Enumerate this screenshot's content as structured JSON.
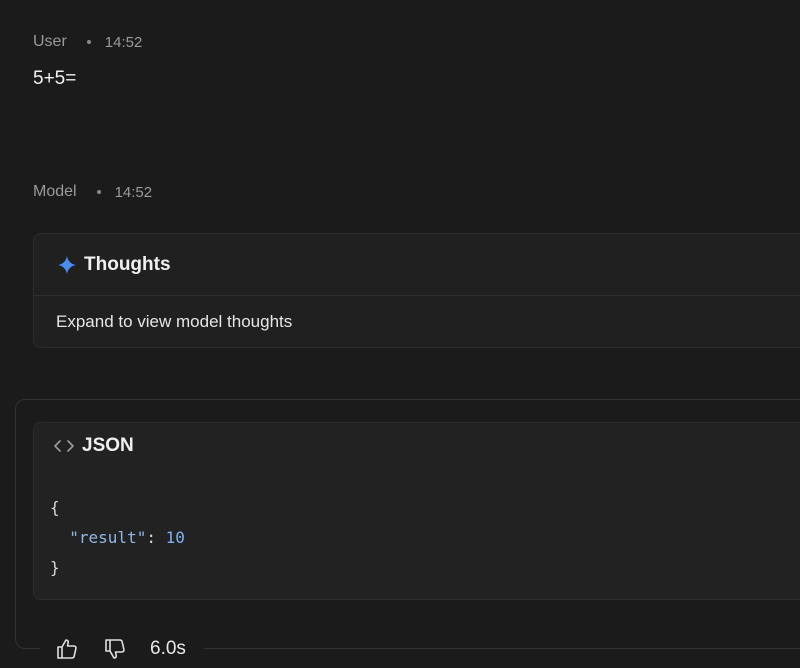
{
  "user_turn": {
    "author": "User",
    "time": "14:52",
    "message": "5+5="
  },
  "model_turn": {
    "author": "Model",
    "time": "14:52",
    "thoughts": {
      "title": "Thoughts",
      "expand_text": "Expand to view model thoughts",
      "icon": "sparkle-icon"
    },
    "json_block": {
      "title": "JSON",
      "icon": "code-icon",
      "open_brace": "{",
      "key": "\"result\"",
      "colon": ": ",
      "value": "10",
      "close_brace": "}"
    },
    "actions": {
      "thumbs_up_icon": "thumbs-up-icon",
      "thumbs_down_icon": "thumbs-down-icon",
      "duration": "6.0s"
    }
  },
  "colors": {
    "background": "#1b1b1c",
    "card": "#202021",
    "sparkle_blue": "#4a8df0",
    "json_value": "#7fb2f0"
  }
}
